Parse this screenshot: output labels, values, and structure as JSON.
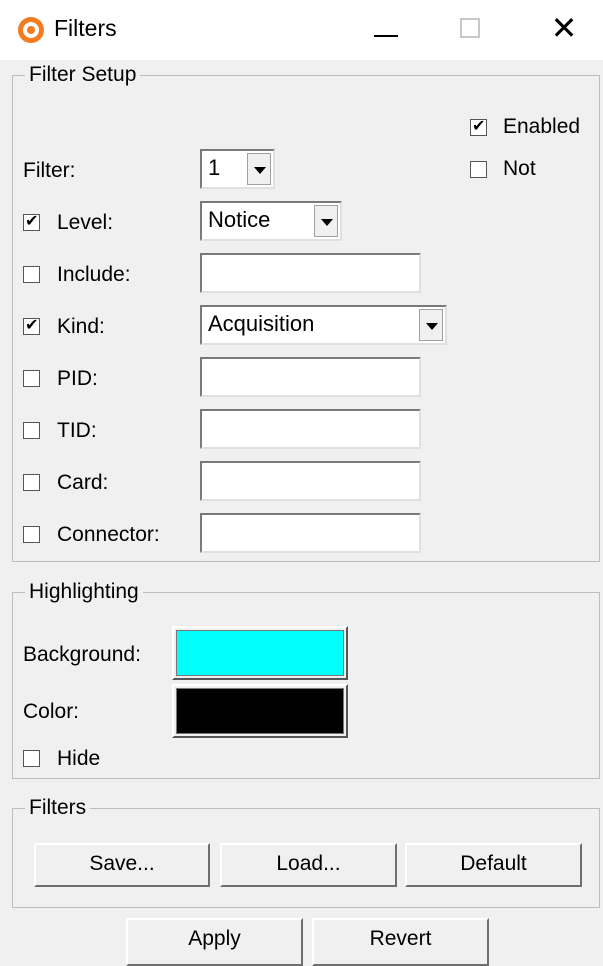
{
  "window": {
    "title": "Filters",
    "close_glyph": "✕"
  },
  "filter_setup": {
    "legend": "Filter Setup",
    "enabled": {
      "label": "Enabled",
      "checked": true
    },
    "not": {
      "label": "Not",
      "checked": false
    },
    "filter": {
      "label": "Filter:",
      "value": "1"
    },
    "level": {
      "label": "Level:",
      "checked": true,
      "value": "Notice"
    },
    "include": {
      "label": "Include:",
      "checked": false,
      "value": ""
    },
    "kind": {
      "label": "Kind:",
      "checked": true,
      "value": "Acquisition"
    },
    "pid": {
      "label": "PID:",
      "checked": false,
      "value": ""
    },
    "tid": {
      "label": "TID:",
      "checked": false,
      "value": ""
    },
    "card": {
      "label": "Card:",
      "checked": false,
      "value": ""
    },
    "connector": {
      "label": "Connector:",
      "checked": false,
      "value": ""
    }
  },
  "highlighting": {
    "legend": "Highlighting",
    "background": {
      "label": "Background:",
      "color": "#00ffff"
    },
    "color": {
      "label": "Color:",
      "color": "#000000"
    },
    "hide": {
      "label": "Hide",
      "checked": false
    }
  },
  "filters": {
    "legend": "Filters",
    "save_label": "Save...",
    "load_label": "Load...",
    "default_label": "Default"
  },
  "footer": {
    "apply_label": "Apply",
    "revert_label": "Revert"
  }
}
